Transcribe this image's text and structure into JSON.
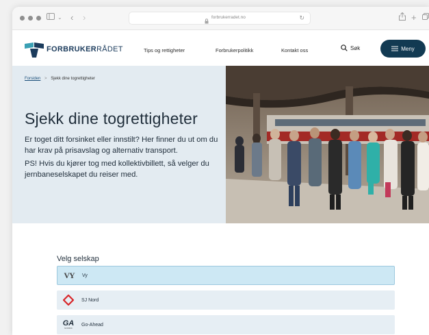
{
  "browser": {
    "url": "forbrukerradet.no",
    "icons": [
      "sidebar-icon",
      "back-icon",
      "forward-icon",
      "shield-icon",
      "lock-icon",
      "reload-icon",
      "share-icon",
      "new-tab-icon",
      "tabs-icon"
    ]
  },
  "header": {
    "logo_bold": "FORBRUKER",
    "logo_thin": "RÅDET",
    "nav": [
      "Tips og rettigheter",
      "Forbrukerpolitikk",
      "Kontakt oss"
    ],
    "search_label": "Søk",
    "menu_label": "Meny",
    "brand_color": "#123a52"
  },
  "hero": {
    "breadcrumb_home": "Forsiden",
    "breadcrumb_separator": ">",
    "breadcrumb_current": "Sjekk dine togrettigheter",
    "title": "Sjekk dine togrettigheter",
    "paragraph1": "Er toget ditt forsinket eller innstilt? Her finner du ut om du har krav på prisavslag og alternativ transport.",
    "paragraph2": "PS! Hvis du kjører tog med kollektivbillett, så velger du jernbaneselskapet du reiser med."
  },
  "selector": {
    "label": "Velg selskap",
    "companies": [
      {
        "name": "Vy",
        "logo": "VY",
        "selected": true
      },
      {
        "name": "SJ Nord",
        "logo": "sj-diamond-icon",
        "selected": false
      },
      {
        "name": "Go-Ahead",
        "logo": "GA",
        "logo_sub": "NORDIC",
        "selected": false
      }
    ]
  }
}
